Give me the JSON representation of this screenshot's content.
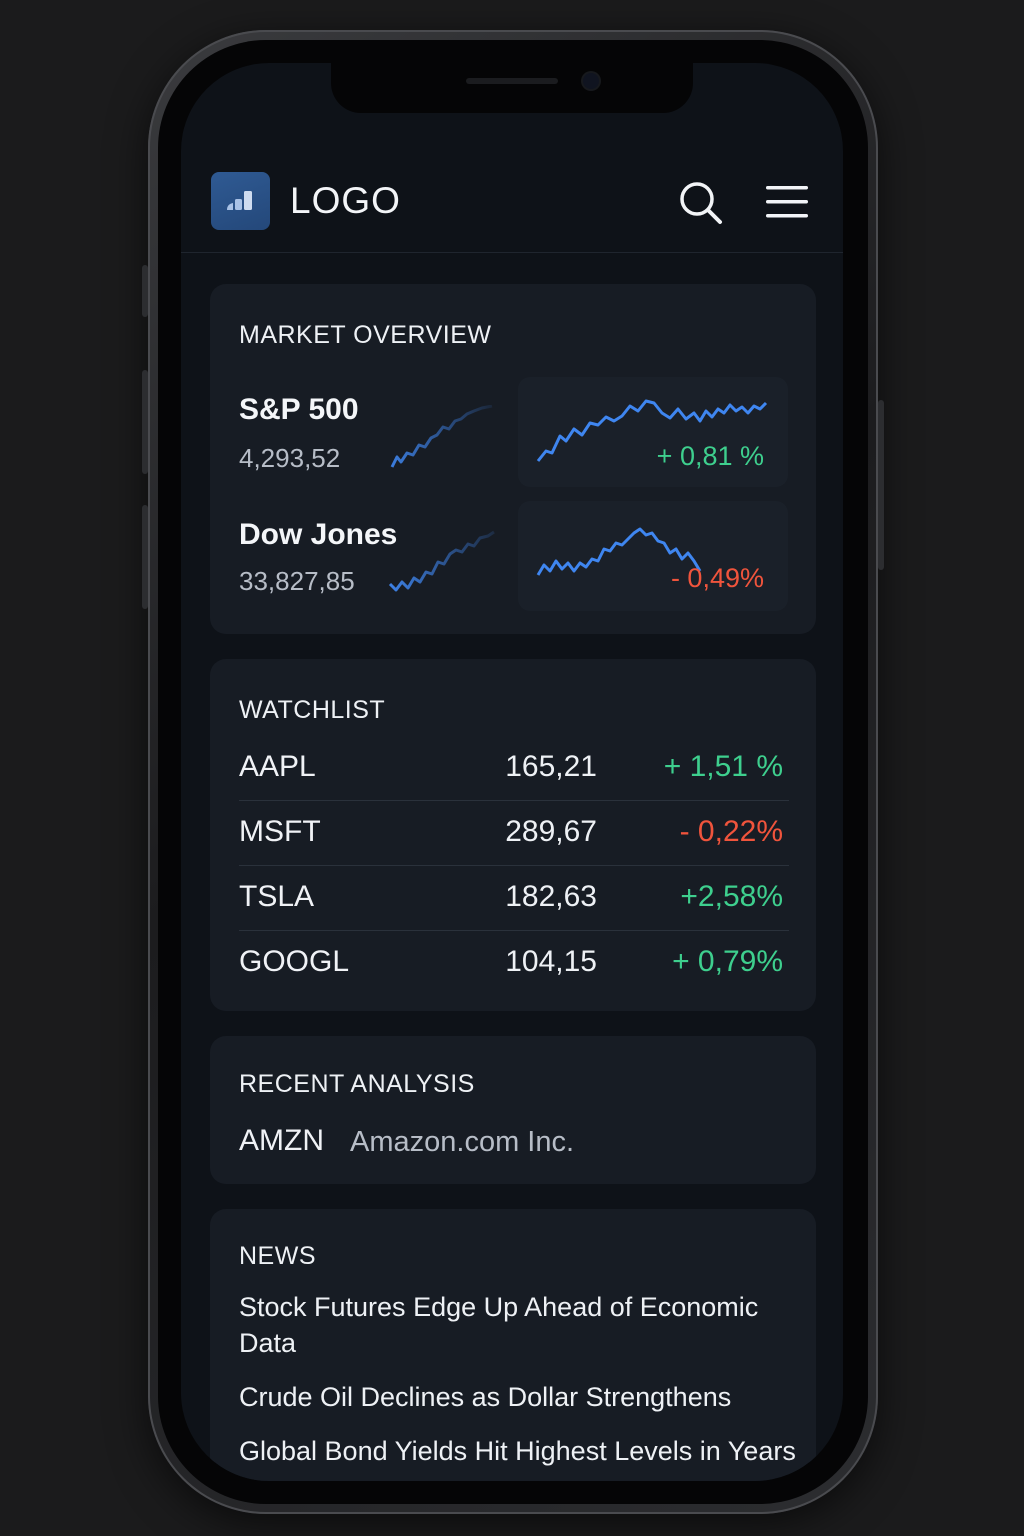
{
  "header": {
    "logo_text": "LOGO",
    "search_icon": "search-icon",
    "menu_icon": "hamburger-menu-icon"
  },
  "market_overview": {
    "title": "MARKET OVERVIEW",
    "indices": [
      {
        "name": "S&P 500",
        "value": "4,293,52",
        "change": "+ 0,81 %",
        "direction": "up"
      },
      {
        "name": "Dow Jones",
        "value": "33,827,85",
        "change": "- 0,49%",
        "direction": "down"
      }
    ]
  },
  "watchlist": {
    "title": "WATCHLIST",
    "rows": [
      {
        "symbol": "AAPL",
        "price": "165,21",
        "change": "+ 1,51 %",
        "direction": "up"
      },
      {
        "symbol": "MSFT",
        "price": "289,67",
        "change": "- 0,22%",
        "direction": "down"
      },
      {
        "symbol": "TSLA",
        "price": "182,63",
        "change": "+2,58%",
        "direction": "up"
      },
      {
        "symbol": "GOOGL",
        "price": "104,15",
        "change": "+ 0,79%",
        "direction": "up"
      }
    ]
  },
  "recent_analysis": {
    "title": "RECENT ANALYSIS",
    "symbol": "AMZN",
    "company": "Amazon.com Inc."
  },
  "news": {
    "title": "NEWS",
    "items": [
      "Stock Futures Edge Up Ahead of Economic Data",
      "Crude Oil Declines as Dollar Strengthens",
      "Global Bond Yields Hit Highest Levels in Years"
    ]
  },
  "colors": {
    "positive": "#3ecf8e",
    "negative": "#f0543c",
    "chart_line": "#3f86f0"
  }
}
